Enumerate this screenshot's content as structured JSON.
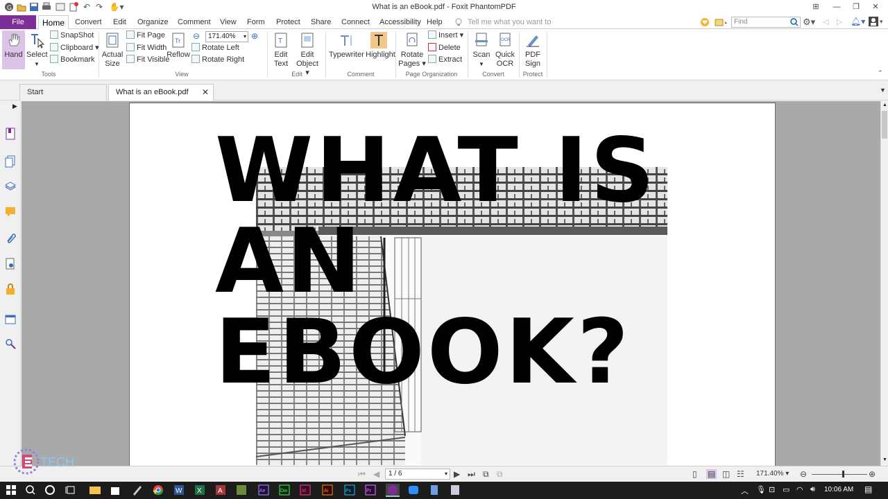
{
  "window": {
    "title": "What is an eBook.pdf - Foxit PhantomPDF",
    "minimize": "—",
    "restore": "❐",
    "close": "✕"
  },
  "menu": {
    "file": "File",
    "tabs": [
      "Home",
      "Convert",
      "Edit",
      "Organize",
      "Comment",
      "View",
      "Form",
      "Protect",
      "Share",
      "Connect",
      "Accessibility",
      "Help"
    ],
    "tell_me": "Tell me what you want to",
    "find_placeholder": "Find"
  },
  "ribbon": {
    "tools": {
      "hand": "Hand",
      "select": "Select",
      "snapshot": "SnapShot",
      "clipboard": "Clipboard",
      "bookmark": "Bookmark",
      "group": "Tools"
    },
    "view": {
      "actual_size_1": "Actual",
      "actual_size_2": "Size",
      "fit_page": "Fit Page",
      "fit_width": "Fit Width",
      "fit_visible": "Fit Visible",
      "reflow": "Reflow",
      "zoom_value": "171.40%",
      "rotate_left": "Rotate Left",
      "rotate_right": "Rotate Right",
      "group": "View"
    },
    "edit": {
      "edit_text_1": "Edit",
      "edit_text_2": "Text",
      "edit_object_1": "Edit",
      "edit_object_2": "Object",
      "group": "Edit"
    },
    "comment": {
      "typewriter": "Typewriter",
      "highlight": "Highlight",
      "group": "Comment"
    },
    "page_org": {
      "rotate_pages_1": "Rotate",
      "rotate_pages_2": "Pages",
      "insert": "Insert",
      "delete": "Delete",
      "extract": "Extract",
      "group": "Page Organization"
    },
    "convert": {
      "scan": "Scan",
      "quick_ocr_1": "Quick",
      "quick_ocr_2": "OCR",
      "group": "Convert"
    },
    "protect": {
      "pdf_sign_1": "PDF",
      "pdf_sign_2": "Sign",
      "group": "Protect"
    }
  },
  "doc_tabs": {
    "start": "Start",
    "current": "What is an eBook.pdf"
  },
  "page_content": {
    "line1": "WHAT IS",
    "line2": "AN",
    "line3": "EBOOK?"
  },
  "status": {
    "page_indicator": "1 / 6",
    "zoom": "171.40%"
  },
  "watermark": "TECH",
  "taskbar": {
    "clock": "10:06 AM"
  }
}
